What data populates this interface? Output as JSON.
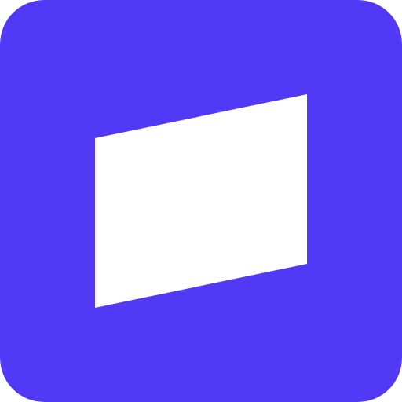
{
  "icon": {
    "name": "app-logo-icon",
    "background_color": "#5139F5",
    "glyph_color": "#FFFFFF",
    "glyph_shape": "parallelogram-panel"
  }
}
